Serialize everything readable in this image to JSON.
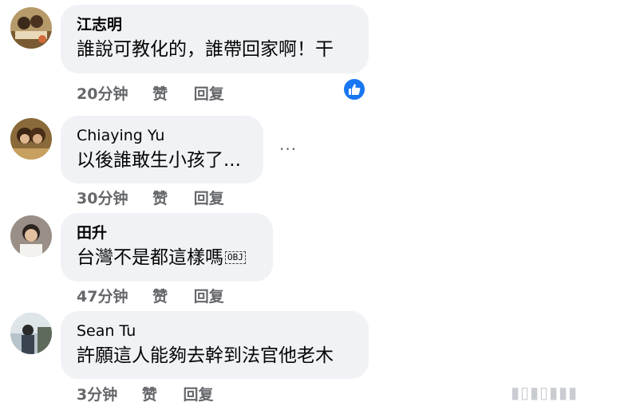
{
  "comments": [
    {
      "author": "江志明",
      "text": "誰說可教化的，誰帶回家啊！干",
      "time": "20分钟",
      "like": "赞",
      "reply": "回复"
    },
    {
      "author": "Chiaying Yu",
      "text": "以後誰敢生小孩了...",
      "time": "30分钟",
      "like": "赞",
      "reply": "回复"
    },
    {
      "author": "田升",
      "text": "台灣不是都這樣嗎",
      "emoji_placeholder": "OBJ",
      "time": "47分钟",
      "like": "赞",
      "reply": "回复"
    },
    {
      "author": "Sean Tu",
      "text": "許願這人能夠去幹到法官他老木",
      "time": "3分钟",
      "like": "赞",
      "reply": "回复"
    }
  ],
  "more_options": "···",
  "watermark": "▮▯▮▯▮▮▮",
  "colors": {
    "bubble": "#f0f2f5",
    "meta": "#65676b",
    "like_blue": "#1877f2"
  },
  "icons": {
    "reaction": "thumbs-up-icon",
    "more": "more-options-icon"
  }
}
